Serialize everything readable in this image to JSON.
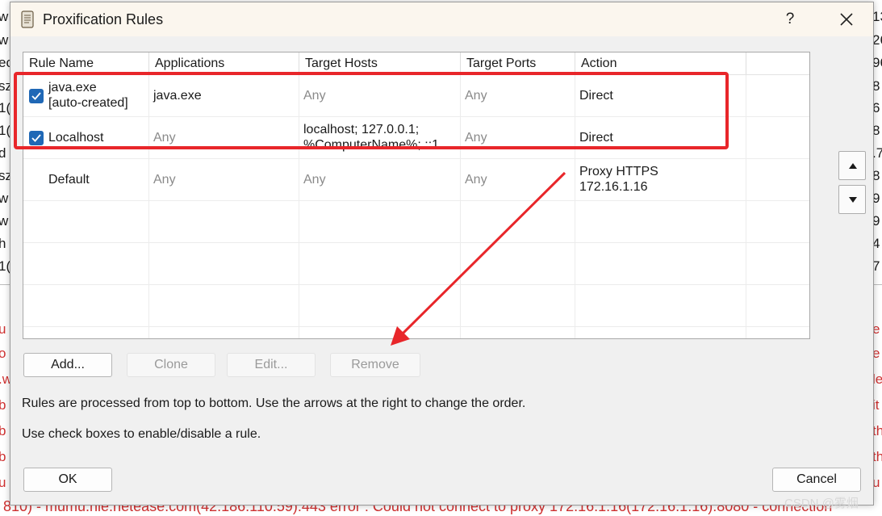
{
  "background": {
    "left_chars": [
      "w",
      "w",
      "ec",
      "sz",
      "1(",
      "1(",
      "d",
      "sz",
      "w",
      "w",
      "h",
      "1("
    ],
    "right_chars": [
      "13",
      "26",
      "96",
      "8",
      "6",
      "8",
      ".7",
      "8",
      "9",
      "9",
      "4",
      "7"
    ],
    "left_chars_red": [
      "u",
      "o",
      ".w",
      "b",
      "b",
      "b",
      "u"
    ],
    "right_chars_red": [
      "e",
      "e",
      "le",
      "it",
      "th",
      "th",
      "u"
    ],
    "bottom_line": "810) - mumu.nie.netease.com(42.186.110.59):443 error : Could not connect to proxy 172.16.1.16(172.16.1.16):8080 - connection"
  },
  "dialog": {
    "title": "Proxification Rules",
    "help_label": "?",
    "table": {
      "columns": [
        "Rule Name",
        "Applications",
        "Target Hosts",
        "Target Ports",
        "Action"
      ],
      "rows": [
        {
          "checked": true,
          "name_line1": "java.exe",
          "name_line2": "[auto-created]",
          "applications": "java.exe",
          "target_hosts_line1": "Any",
          "target_hosts_line2": "",
          "target_ports": "Any",
          "action_line1": "Direct",
          "action_line2": ""
        },
        {
          "checked": true,
          "name_line1": "Localhost",
          "name_line2": "",
          "applications": "Any",
          "target_hosts_line1": "localhost; 127.0.0.1;",
          "target_hosts_line2": "%ComputerName%; ::1",
          "target_ports": "Any",
          "action_line1": "Direct",
          "action_line2": ""
        },
        {
          "checked": false,
          "name_line1": "Default",
          "name_line2": "",
          "applications": "Any",
          "target_hosts_line1": "Any",
          "target_hosts_line2": "",
          "target_ports": "Any",
          "action_line1": "Proxy HTTPS",
          "action_line2": "172.16.1.16"
        }
      ]
    },
    "buttons": {
      "add": "Add...",
      "clone": "Clone",
      "edit": "Edit...",
      "remove": "Remove",
      "ok": "OK",
      "cancel": "Cancel"
    },
    "info_line1": "Rules are processed from top to bottom. Use the arrows at the right to change the order.",
    "info_line2": "Use check boxes to enable/disable a rule."
  },
  "watermark": "CSDN @雾烟",
  "colors": {
    "annotation_red": "#e8262a",
    "checkbox_blue": "#1f68b6",
    "background_error_text": "#d03030"
  }
}
